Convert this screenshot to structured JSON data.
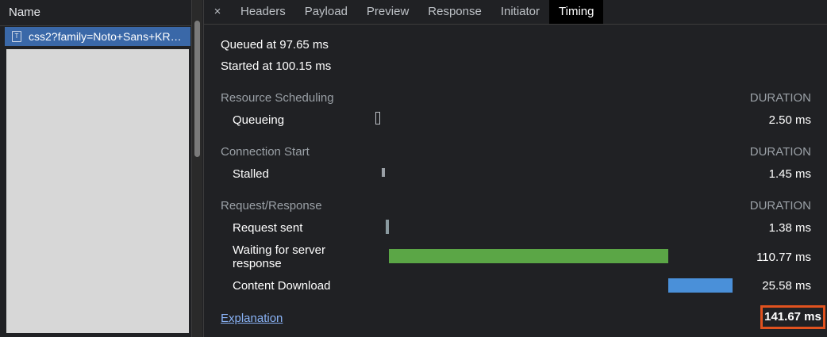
{
  "request_list": {
    "header": "Name",
    "selected_request": "css2?family=Noto+Sans+KR&display=swap",
    "request_icon": "document-icon"
  },
  "tabs": {
    "close_icon": "×",
    "items": [
      "Headers",
      "Payload",
      "Preview",
      "Response",
      "Initiator",
      "Timing"
    ],
    "active": "Timing"
  },
  "timing": {
    "queued_at": "Queued at 97.65 ms",
    "started_at": "Started at 100.15 ms",
    "sections": [
      {
        "title": "Resource Scheduling",
        "duration_header": "DURATION",
        "rows": [
          {
            "label": "Queueing",
            "value": "2.50 ms",
            "style": "outline"
          }
        ]
      },
      {
        "title": "Connection Start",
        "duration_header": "DURATION",
        "rows": [
          {
            "label": "Stalled",
            "value": "1.45 ms",
            "style": "gray"
          }
        ]
      },
      {
        "title": "Request/Response",
        "duration_header": "DURATION",
        "rows": [
          {
            "label": "Request sent",
            "value": "1.38 ms",
            "style": "teal"
          },
          {
            "label": "Waiting for server response",
            "value": "110.77 ms",
            "style": "green"
          },
          {
            "label": "Content Download",
            "value": "25.58 ms",
            "style": "blue"
          }
        ]
      }
    ],
    "explanation_link": "Explanation",
    "total": "141.67 ms"
  },
  "colors": {
    "waiting_bar": "#5ba646",
    "download_bar": "#4a90d9",
    "highlight_border": "#e0521f",
    "selected_row": "#3a68a8"
  }
}
